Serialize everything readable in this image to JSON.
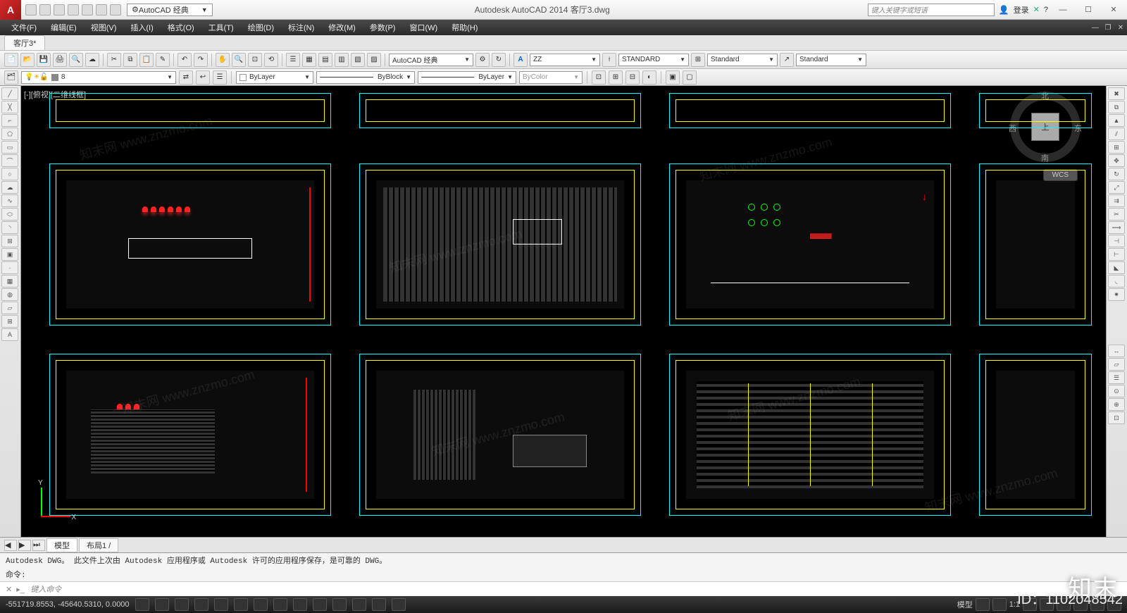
{
  "title": "Autodesk AutoCAD 2014    客厅3.dwg",
  "workspace": "AutoCAD 经典",
  "search_placeholder": "键入关键字或短语",
  "login": "登录",
  "menus": [
    "文件(F)",
    "编辑(E)",
    "视图(V)",
    "插入(I)",
    "格式(O)",
    "工具(T)",
    "绘图(D)",
    "标注(N)",
    "修改(M)",
    "参数(P)",
    "窗口(W)",
    "帮助(H)"
  ],
  "file_tab": "客厅3*",
  "toolbar1": {
    "style_sel": "AutoCAD 经典",
    "text_style": "ZZ",
    "dim_style": "STANDARD",
    "table_style": "Standard",
    "mleader_style": "Standard"
  },
  "layerbar": {
    "layer": "8",
    "color_sel": "ByLayer",
    "ltype_sel": "ByBlock",
    "lweight_sel": "ByLayer",
    "plot_sel": "ByColor"
  },
  "view_label": "[-][俯视][二维线框]",
  "viewcube": {
    "face": "上",
    "n": "北",
    "s": "南",
    "e": "东",
    "w": "西"
  },
  "wcs": "WCS",
  "ucs": {
    "x": "X",
    "y": "Y"
  },
  "model_tabs": {
    "model": "模型",
    "layout": "布局1"
  },
  "cmd_history": "Autodesk DWG。  此文件上次由 Autodesk 应用程序或 Autodesk 许可的应用程序保存，是可靠的 DWG。",
  "cmd_prompt": "命令:",
  "cmd_placeholder": "键入命令",
  "coords": "-551719.8553, -45640.5310, 0.0000",
  "status_right": {
    "model": "模型",
    "a1": "1:1"
  },
  "brand": "知末",
  "brand_id": "ID：1102048542",
  "watermark": "知末网 www.znzmo.com"
}
